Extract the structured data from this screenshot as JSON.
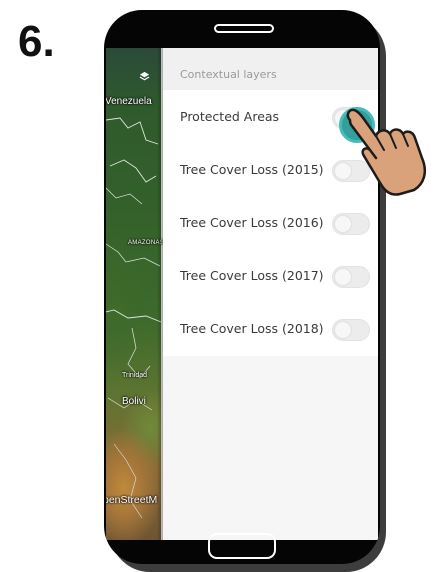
{
  "step": {
    "number": "6."
  },
  "map": {
    "labels": {
      "venezuela": "Venezuela",
      "amazonas": "AMAZONAS",
      "bolivia": "Bolivi",
      "trinidad": "Trinidad",
      "attribution": "penStreetM"
    }
  },
  "panel": {
    "title": "Contextual layers",
    "layers": [
      {
        "label": "Protected Areas",
        "enabled": false
      },
      {
        "label": "Tree Cover Loss (2015)",
        "enabled": false
      },
      {
        "label": "Tree Cover Loss (2016)",
        "enabled": false
      },
      {
        "label": "Tree Cover Loss (2017)",
        "enabled": false
      },
      {
        "label": "Tree Cover Loss (2018)",
        "enabled": false
      }
    ]
  },
  "icons": {
    "layers": "layers-icon",
    "pointer": "pointing-hand-icon"
  },
  "colors": {
    "tap_indicator": "#2a9a97",
    "phone_body": "#050505",
    "panel_background": "#f6f6f6"
  }
}
